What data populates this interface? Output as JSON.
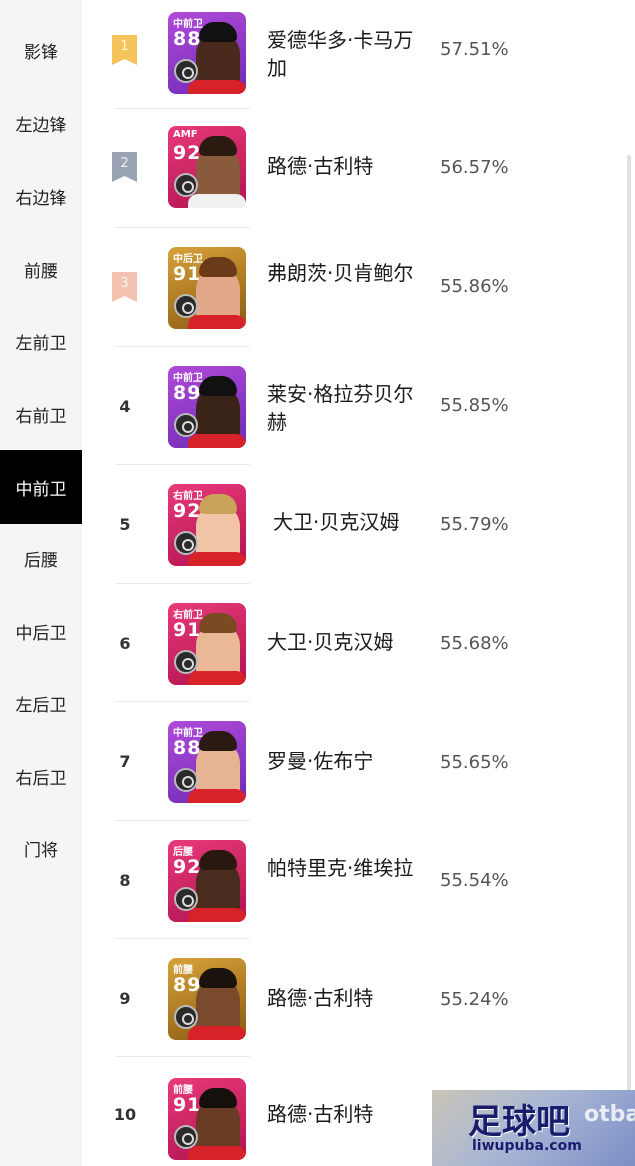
{
  "sidebar": {
    "items": [
      {
        "label": "影锋",
        "active": false
      },
      {
        "label": "左边锋",
        "active": false
      },
      {
        "label": "右边锋",
        "active": false
      },
      {
        "label": "前腰",
        "active": false
      },
      {
        "label": "左前卫",
        "active": false
      },
      {
        "label": "右前卫",
        "active": false
      },
      {
        "label": "中前卫",
        "active": true
      },
      {
        "label": "后腰",
        "active": false
      },
      {
        "label": "中后卫",
        "active": false
      },
      {
        "label": "左后卫",
        "active": false
      },
      {
        "label": "右后卫",
        "active": false
      },
      {
        "label": "门将",
        "active": false
      }
    ]
  },
  "players": [
    {
      "rank": "1",
      "position": "中前卫",
      "rating": "88",
      "name": "爱德华多·卡马万加",
      "percent": "57.51%"
    },
    {
      "rank": "2",
      "position": "AMF",
      "rating": "92",
      "name": "路德·古利特",
      "percent": "56.57%"
    },
    {
      "rank": "3",
      "position": "中后卫",
      "rating": "91",
      "name": "弗朗茨·贝肯鲍尔",
      "percent": "55.86%"
    },
    {
      "rank": "4",
      "position": "中前卫",
      "rating": "89",
      "name": "莱安·格拉芬贝尔赫",
      "percent": "55.85%"
    },
    {
      "rank": "5",
      "position": "右前卫",
      "rating": "92",
      "name": "大卫·贝克汉姆",
      "percent": "55.79%"
    },
    {
      "rank": "6",
      "position": "右前卫",
      "rating": "91",
      "name": "大卫·贝克汉姆",
      "percent": "55.68%"
    },
    {
      "rank": "7",
      "position": "中前卫",
      "rating": "88",
      "name": "罗曼·佐布宁",
      "percent": "55.65%"
    },
    {
      "rank": "8",
      "position": "后腰",
      "rating": "92",
      "name": "帕特里克·维埃拉",
      "percent": "55.54%"
    },
    {
      "rank": "9",
      "position": "前腰",
      "rating": "89",
      "name": "路德·古利特",
      "percent": "55.24%"
    },
    {
      "rank": "10",
      "position": "前腰",
      "rating": "91",
      "name": "路德·古利特",
      "percent": ""
    }
  ],
  "watermark": {
    "title": "足球吧",
    "site": "liwupuba.com",
    "side_text": "otba"
  },
  "colors": {
    "gold_flag": "#f6c35a",
    "silver_flag": "#9aa3b3",
    "bronze_flag": "#f2c2ae",
    "active_bg": "#000000"
  }
}
